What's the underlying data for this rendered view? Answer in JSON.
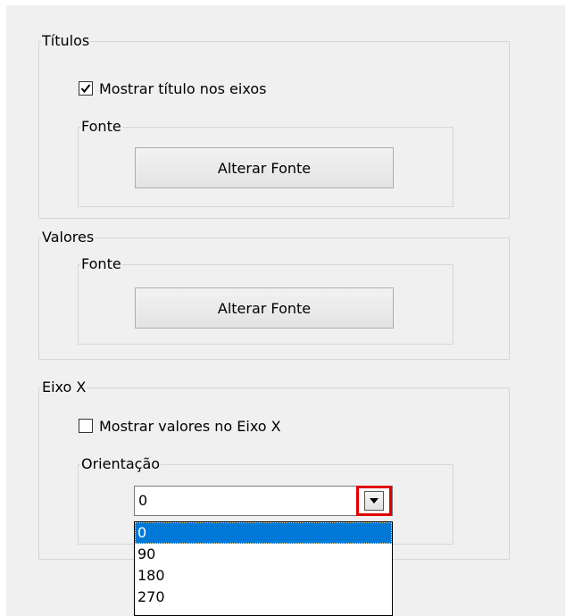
{
  "titulos_group": {
    "legend": "Títulos",
    "show_axis_titles": {
      "label": "Mostrar título nos eixos",
      "checked": true
    },
    "font_group": {
      "legend": "Fonte",
      "button_label": "Alterar Fonte"
    }
  },
  "valores_group": {
    "legend": "Valores",
    "font_group": {
      "legend": "Fonte",
      "button_label": "Alterar Fonte"
    }
  },
  "eixo_x_group": {
    "legend": "Eixo X",
    "show_x_values": {
      "label": "Mostrar valores no Eixo X",
      "checked": false
    },
    "orientation_group": {
      "legend": "Orientação",
      "combo_value": "0",
      "options": [
        "0",
        "90",
        "180",
        "270"
      ],
      "selected_index": 0
    }
  },
  "colors": {
    "highlight": "#e00000",
    "selection": "#0078d7"
  },
  "icons": {
    "checkmark": "checkmark-icon",
    "dropdown": "chevron-down-icon"
  }
}
